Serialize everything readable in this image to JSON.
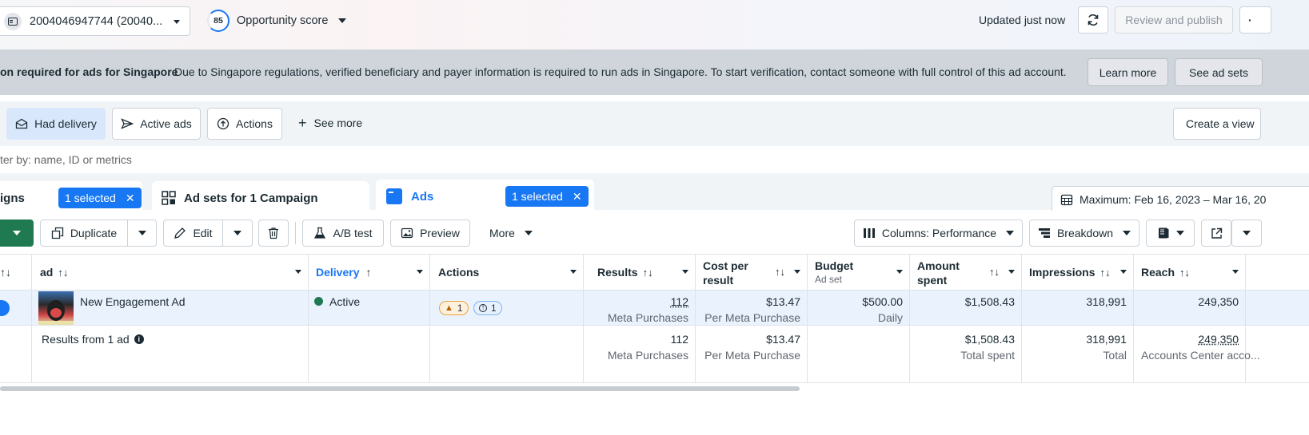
{
  "topbar": {
    "account": "2004046947744 (20040...",
    "score_value": "85",
    "score_label": "Opportunity score",
    "updated": "Updated just now",
    "review_publish": "Review and publish"
  },
  "banner": {
    "title": "on required for ads for Singapore",
    "message": "Due to Singapore regulations, verified beneficiary and payer information is required to run ads in Singapore. To start verification, contact someone with full control of this ad account.",
    "learn_more": "Learn more",
    "see_ad_sets": "See ad sets"
  },
  "filters": {
    "had_delivery": "Had delivery",
    "active_ads": "Active ads",
    "actions": "Actions",
    "see_more": "See more",
    "create_view": "Create a view"
  },
  "search": {
    "placeholder": "ter by: name, ID or metrics"
  },
  "tabs": {
    "campaigns": "igns",
    "campaigns_selected": "1 selected",
    "adsets": "Ad sets for 1 Campaign",
    "ads": "Ads",
    "ads_selected": "1 selected",
    "date_range": "Maximum: Feb 16, 2023 – Mar 16, 20"
  },
  "toolbar": {
    "duplicate": "Duplicate",
    "edit": "Edit",
    "ab_test": "A/B test",
    "preview": "Preview",
    "more": "More",
    "columns": "Columns: Performance",
    "breakdown": "Breakdown"
  },
  "table": {
    "headers": {
      "ad": "ad",
      "delivery": "Delivery",
      "actions": "Actions",
      "results": "Results",
      "cost_per_result": "Cost per result",
      "budget": "Budget",
      "budget_sub": "Ad set",
      "amount_spent": "Amount spent",
      "impressions": "Impressions",
      "reach": "Reach"
    },
    "row": {
      "name": "New Engagement Ad",
      "delivery": "Active",
      "warnings": "1",
      "actions_count": "1",
      "results": "112",
      "results_sub": "Meta Purchases",
      "cost": "$13.47",
      "cost_sub": "Per Meta Purchase",
      "budget": "$500.00",
      "budget_sub": "Daily",
      "spent": "$1,508.43",
      "impressions": "318,991",
      "reach": "249,350"
    },
    "summary": {
      "label": "Results from 1 ad",
      "results": "112",
      "results_sub": "Meta Purchases",
      "cost": "$13.47",
      "cost_sub": "Per Meta Purchase",
      "spent": "$1,508.43",
      "spent_sub": "Total spent",
      "impressions": "318,991",
      "impressions_sub": "Total",
      "reach": "249,350",
      "reach_sub": "Accounts Center acco..."
    }
  },
  "colors": {
    "accent": "#1877f2",
    "active_green": "#1f7a52",
    "publish_green": "#1f7a52"
  }
}
